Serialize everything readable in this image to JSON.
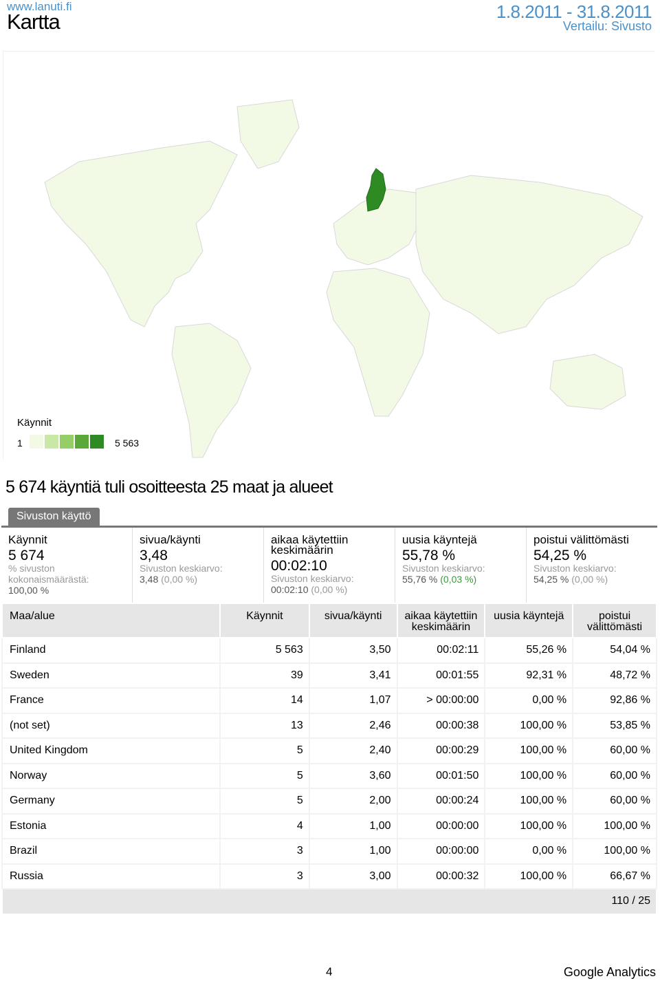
{
  "header": {
    "site": "www.lanuti.fi",
    "title": "Kartta",
    "date_range": "1.8.2011 - 31.8.2011",
    "compare": "Vertailu: Sivusto"
  },
  "map": {
    "highlight_color": "#2e8b24",
    "land_color": "#f2fae6",
    "legend": {
      "title": "Käynnit",
      "min": "1",
      "max": "5 563",
      "colors": [
        "#f2fae6",
        "#c9e8a6",
        "#95cd66",
        "#5aa73a",
        "#2e8b24"
      ]
    }
  },
  "headline": "5 674 käyntiä tuli osoitteesta 25 maat ja alueet",
  "tab": "Sivuston käyttö",
  "metrics": [
    {
      "label": "Käynnit",
      "value": "5 674",
      "sub1": "% sivuston kokonaismäärästä:",
      "sub2": "100,00 %",
      "sub3": ""
    },
    {
      "label": "sivua/käynti",
      "value": "3,48",
      "sub1": "Sivuston keskiarvo:",
      "sub2": "3,48",
      "sub3": "(0,00 %)"
    },
    {
      "label": "aikaa käytettiin keskimäärin",
      "value": "00:02:10",
      "sub1": "Sivuston keskiarvo:",
      "sub2": "00:02:10",
      "sub3": "(0,00 %)"
    },
    {
      "label": "uusia käyntejä",
      "value": "55,78 %",
      "sub1": "Sivuston keskiarvo:",
      "sub2": "55,76 %",
      "sub3": "(0,03 %)"
    },
    {
      "label": "poistui välittömästi",
      "value": "54,25 %",
      "sub1": "Sivuston keskiarvo:",
      "sub2": "54,25 %",
      "sub3": "(0,00 %)"
    }
  ],
  "table": {
    "headers": [
      "Maa/alue",
      "Käynnit",
      "sivua/käynti",
      "aikaa käytettiin keskimäärin",
      "uusia käyntejä",
      "poistui välittömästi"
    ],
    "rows": [
      [
        "Finland",
        "5 563",
        "3,50",
        "00:02:11",
        "55,26 %",
        "54,04 %"
      ],
      [
        "Sweden",
        "39",
        "3,41",
        "00:01:55",
        "92,31 %",
        "48,72 %"
      ],
      [
        "France",
        "14",
        "1,07",
        "> 00:00:00",
        "0,00 %",
        "92,86 %"
      ],
      [
        "(not set)",
        "13",
        "2,46",
        "00:00:38",
        "100,00 %",
        "53,85 %"
      ],
      [
        "United Kingdom",
        "5",
        "2,40",
        "00:00:29",
        "100,00 %",
        "60,00 %"
      ],
      [
        "Norway",
        "5",
        "3,60",
        "00:01:50",
        "100,00 %",
        "60,00 %"
      ],
      [
        "Germany",
        "5",
        "2,00",
        "00:00:24",
        "100,00 %",
        "60,00 %"
      ],
      [
        "Estonia",
        "4",
        "1,00",
        "00:00:00",
        "100,00 %",
        "100,00 %"
      ],
      [
        "Brazil",
        "3",
        "1,00",
        "00:00:00",
        "0,00 %",
        "100,00 %"
      ],
      [
        "Russia",
        "3",
        "3,00",
        "00:00:32",
        "100,00 %",
        "66,67 %"
      ]
    ],
    "pagination": "110 / 25"
  },
  "footer": {
    "page": "4",
    "brand": "Google Analytics"
  }
}
